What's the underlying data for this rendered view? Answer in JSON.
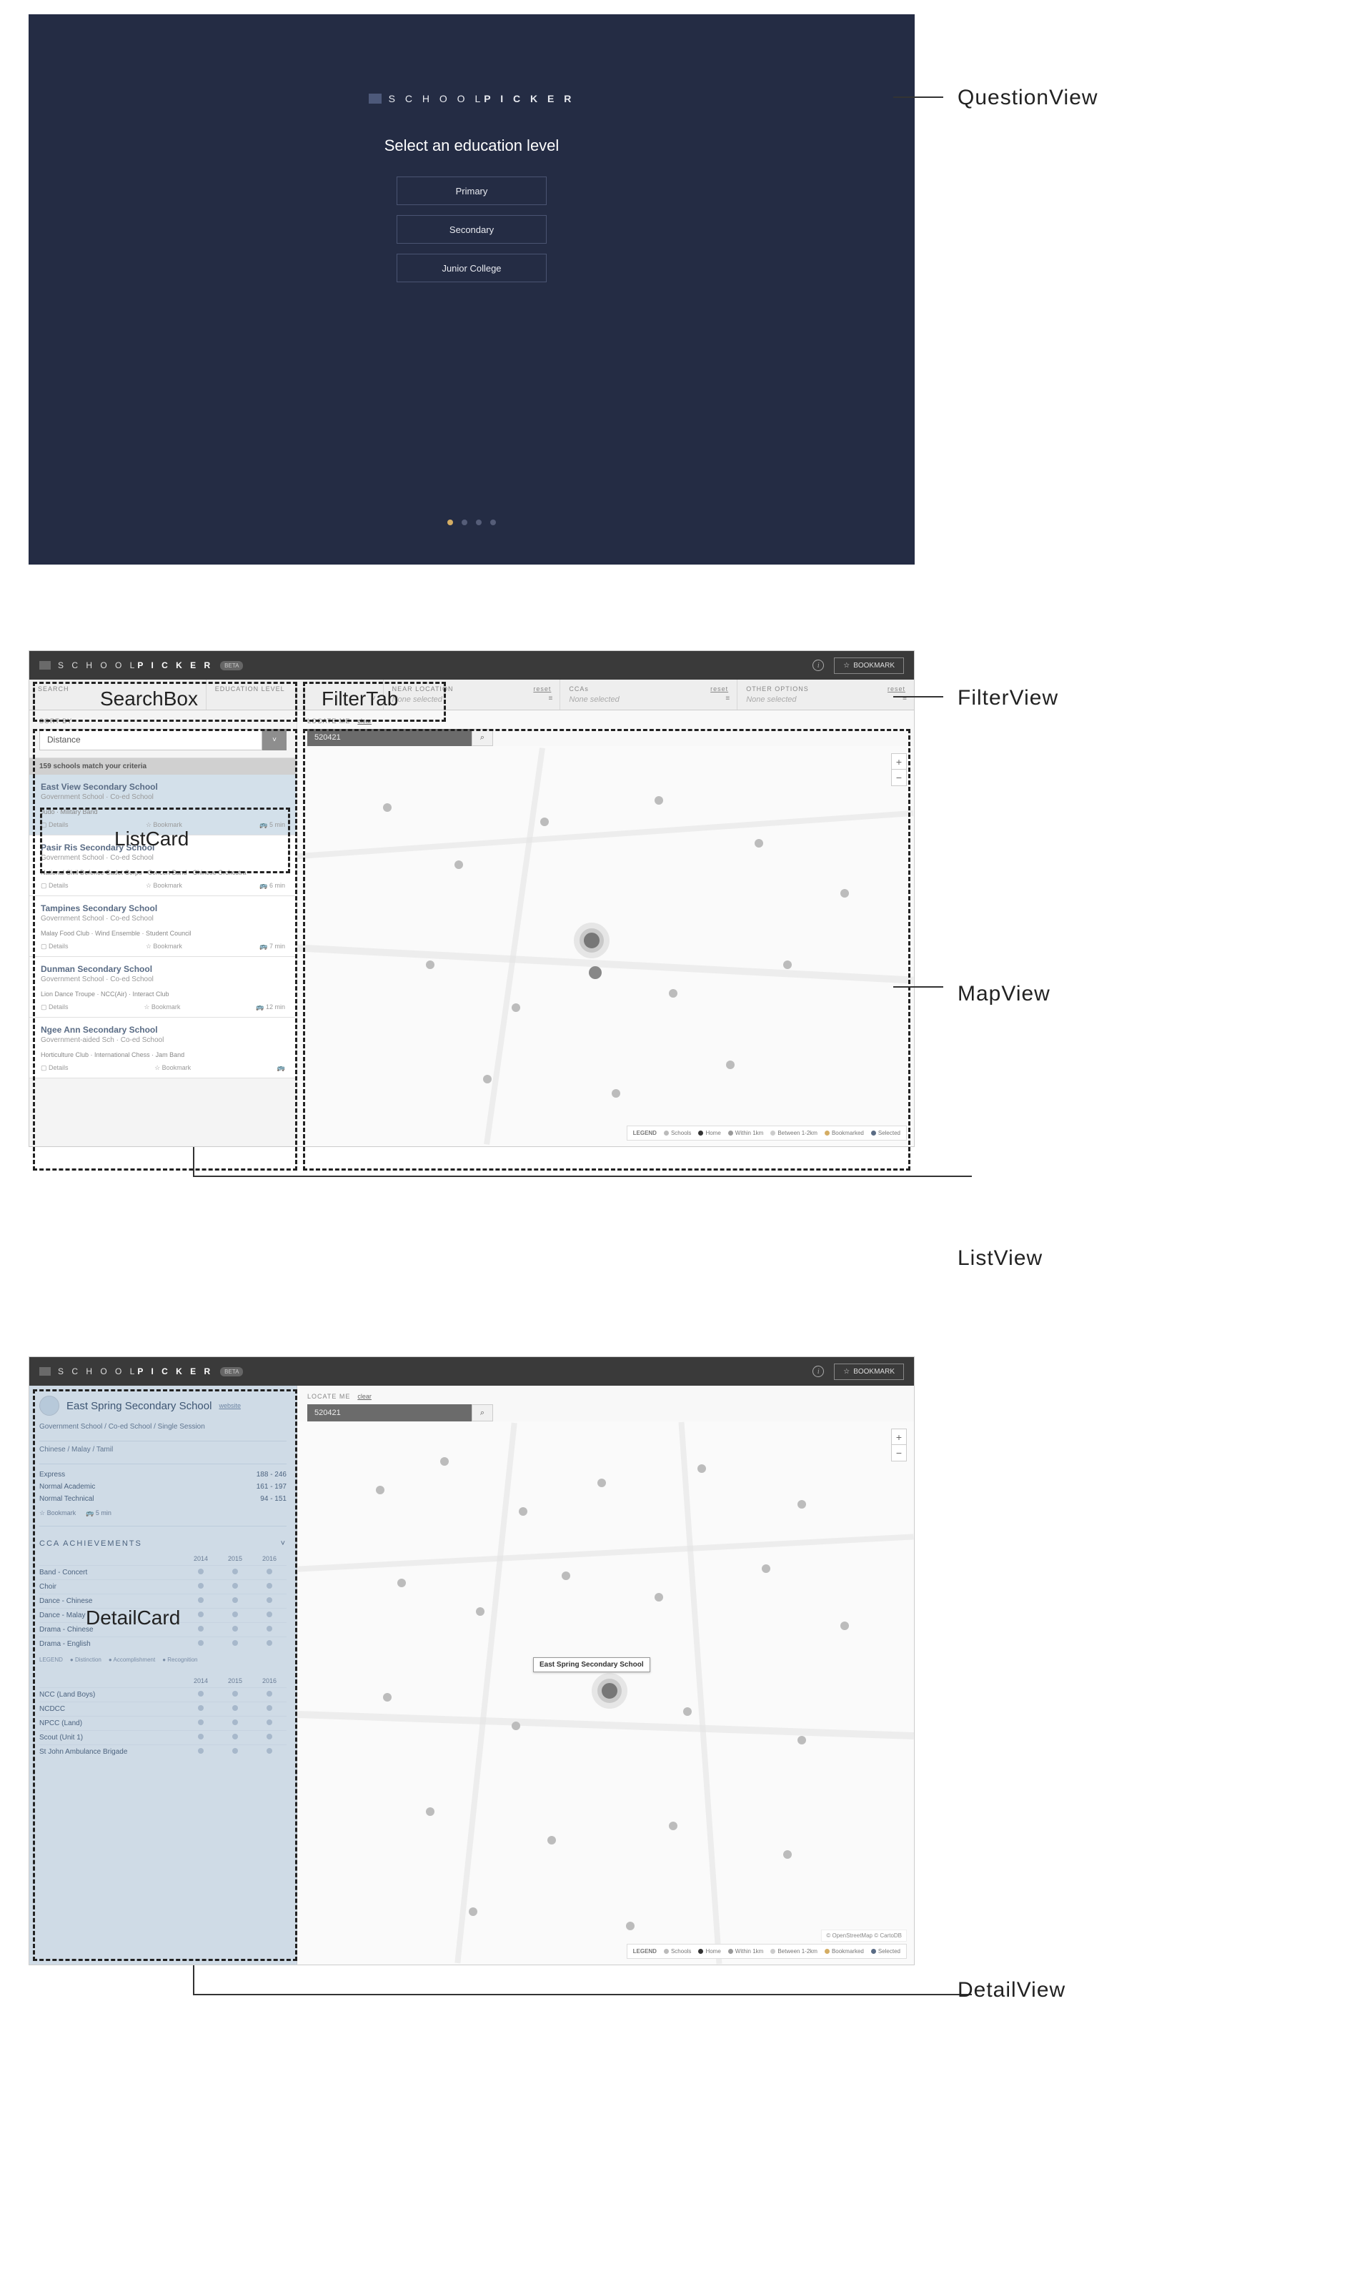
{
  "labels": {
    "questionView": "QuestionView",
    "filterView": "FilterView",
    "mapView": "MapView",
    "listView": "ListView",
    "detailView": "DetailView",
    "searchBox": "SearchBox",
    "filterTab": "FilterTab",
    "listCard": "ListCard",
    "detailCard": "DetailCard"
  },
  "questionView": {
    "brand_prefix": "S C H O O L",
    "brand_suffix": "P I C K E R",
    "heading": "Select an education level",
    "options": [
      "Primary",
      "Secondary",
      "Junior College"
    ],
    "dot_count": 4,
    "dot_active": 0
  },
  "appHeader": {
    "brand_prefix": "S C H O O L",
    "brand_suffix": "P I C K E R",
    "badge": "BETA",
    "info_glyph": "i",
    "bookmark_star": "☆",
    "bookmark_label": "BOOKMARK"
  },
  "filterBar": {
    "cells": [
      {
        "label": "SEARCH",
        "reset": "",
        "value": ""
      },
      {
        "label": "EDUCATION LEVEL",
        "reset": "",
        "value": ""
      },
      {
        "label": "NEAR LOCATION",
        "reset": "reset",
        "value": "None selected"
      },
      {
        "label": "CCAs",
        "reset": "reset",
        "value": "None selected"
      },
      {
        "label": "OTHER OPTIONS",
        "reset": "reset",
        "value": "None selected"
      }
    ]
  },
  "listPane": {
    "sort_label": "SORT BY",
    "sort_value": "Distance",
    "match_text": "159 schools match your criteria",
    "cards": [
      {
        "title": "East View Secondary School",
        "sub": "Government School  ·  Co-ed School",
        "tags": "Judo  ·   Military Band",
        "details": "Details",
        "bookmark": "Bookmark",
        "time": "5 min",
        "selected": true
      },
      {
        "title": "Pasir Ris Secondary School",
        "sub": "Government School  ·  Co-ed School",
        "tags": "National Civil Defence Cadet Corps  ·  Concert Band  ·  Chinese Orchestra",
        "details": "Details",
        "bookmark": "Bookmark",
        "time": "6 min",
        "selected": false
      },
      {
        "title": "Tampines Secondary School",
        "sub": "Government School  ·  Co-ed School",
        "tags": "Malay Food Club  ·  Wind Ensemble  ·  Student Council",
        "details": "Details",
        "bookmark": "Bookmark",
        "time": "7 min",
        "selected": false
      },
      {
        "title": "Dunman Secondary School",
        "sub": "Government School  ·  Co-ed School",
        "tags": "Lion Dance Troupe  ·  NCC(Air)  ·  Interact Club",
        "details": "Details",
        "bookmark": "Bookmark",
        "time": "12 min",
        "selected": false
      },
      {
        "title": "Ngee Ann Secondary School",
        "sub": "Government-aided Sch  ·  Co-ed School",
        "tags": "Horticulture Club  ·  International Chess  ·  Jam Band",
        "details": "Details",
        "bookmark": "Bookmark",
        "time": "",
        "selected": false
      }
    ]
  },
  "mapPane": {
    "locate_label": "LOCATE ME",
    "locate_clear": "clear",
    "locate_value": "520421",
    "search_glyph": "⌕",
    "zoom_plus": "+",
    "zoom_minus": "−",
    "legend_title": "LEGEND",
    "legend_items": [
      "Schools",
      "Home",
      "Within 1km",
      "Between 1-2km",
      "Bookmarked",
      "Selected"
    ],
    "attribution": "© OpenStreetMap © CartoDB"
  },
  "detailView": {
    "school_name": "East Spring Secondary School",
    "website": "website",
    "type_line": "Government School / Co-ed School / Single Session",
    "lang_line": "Chinese / Malay / Tamil",
    "streams": [
      {
        "name": "Express",
        "range": "188 - 246"
      },
      {
        "name": "Normal Academic",
        "range": "161 - 197"
      },
      {
        "name": "Normal Technical",
        "range": "94 - 151"
      }
    ],
    "bookmark": "Bookmark",
    "travel": "5 min",
    "cca_heading": "CCA ACHIEVEMENTS",
    "chevron": "˅",
    "years": [
      "2014",
      "2015",
      "2016"
    ],
    "ccas1": [
      "Band - Concert",
      "Choir",
      "Dance - Chinese",
      "Dance - Malay",
      "Drama - Chinese",
      "Drama - English"
    ],
    "cca_legend": [
      "LEGEND",
      "Distinction",
      "Accomplishment",
      "Recognition"
    ],
    "ccas2": [
      "NCC (Land Boys)",
      "NCDCC",
      "NPCC (Land)",
      "Scout (Unit 1)",
      "St John Ambulance Brigade"
    ],
    "tooltip": "East Spring Secondary School"
  }
}
